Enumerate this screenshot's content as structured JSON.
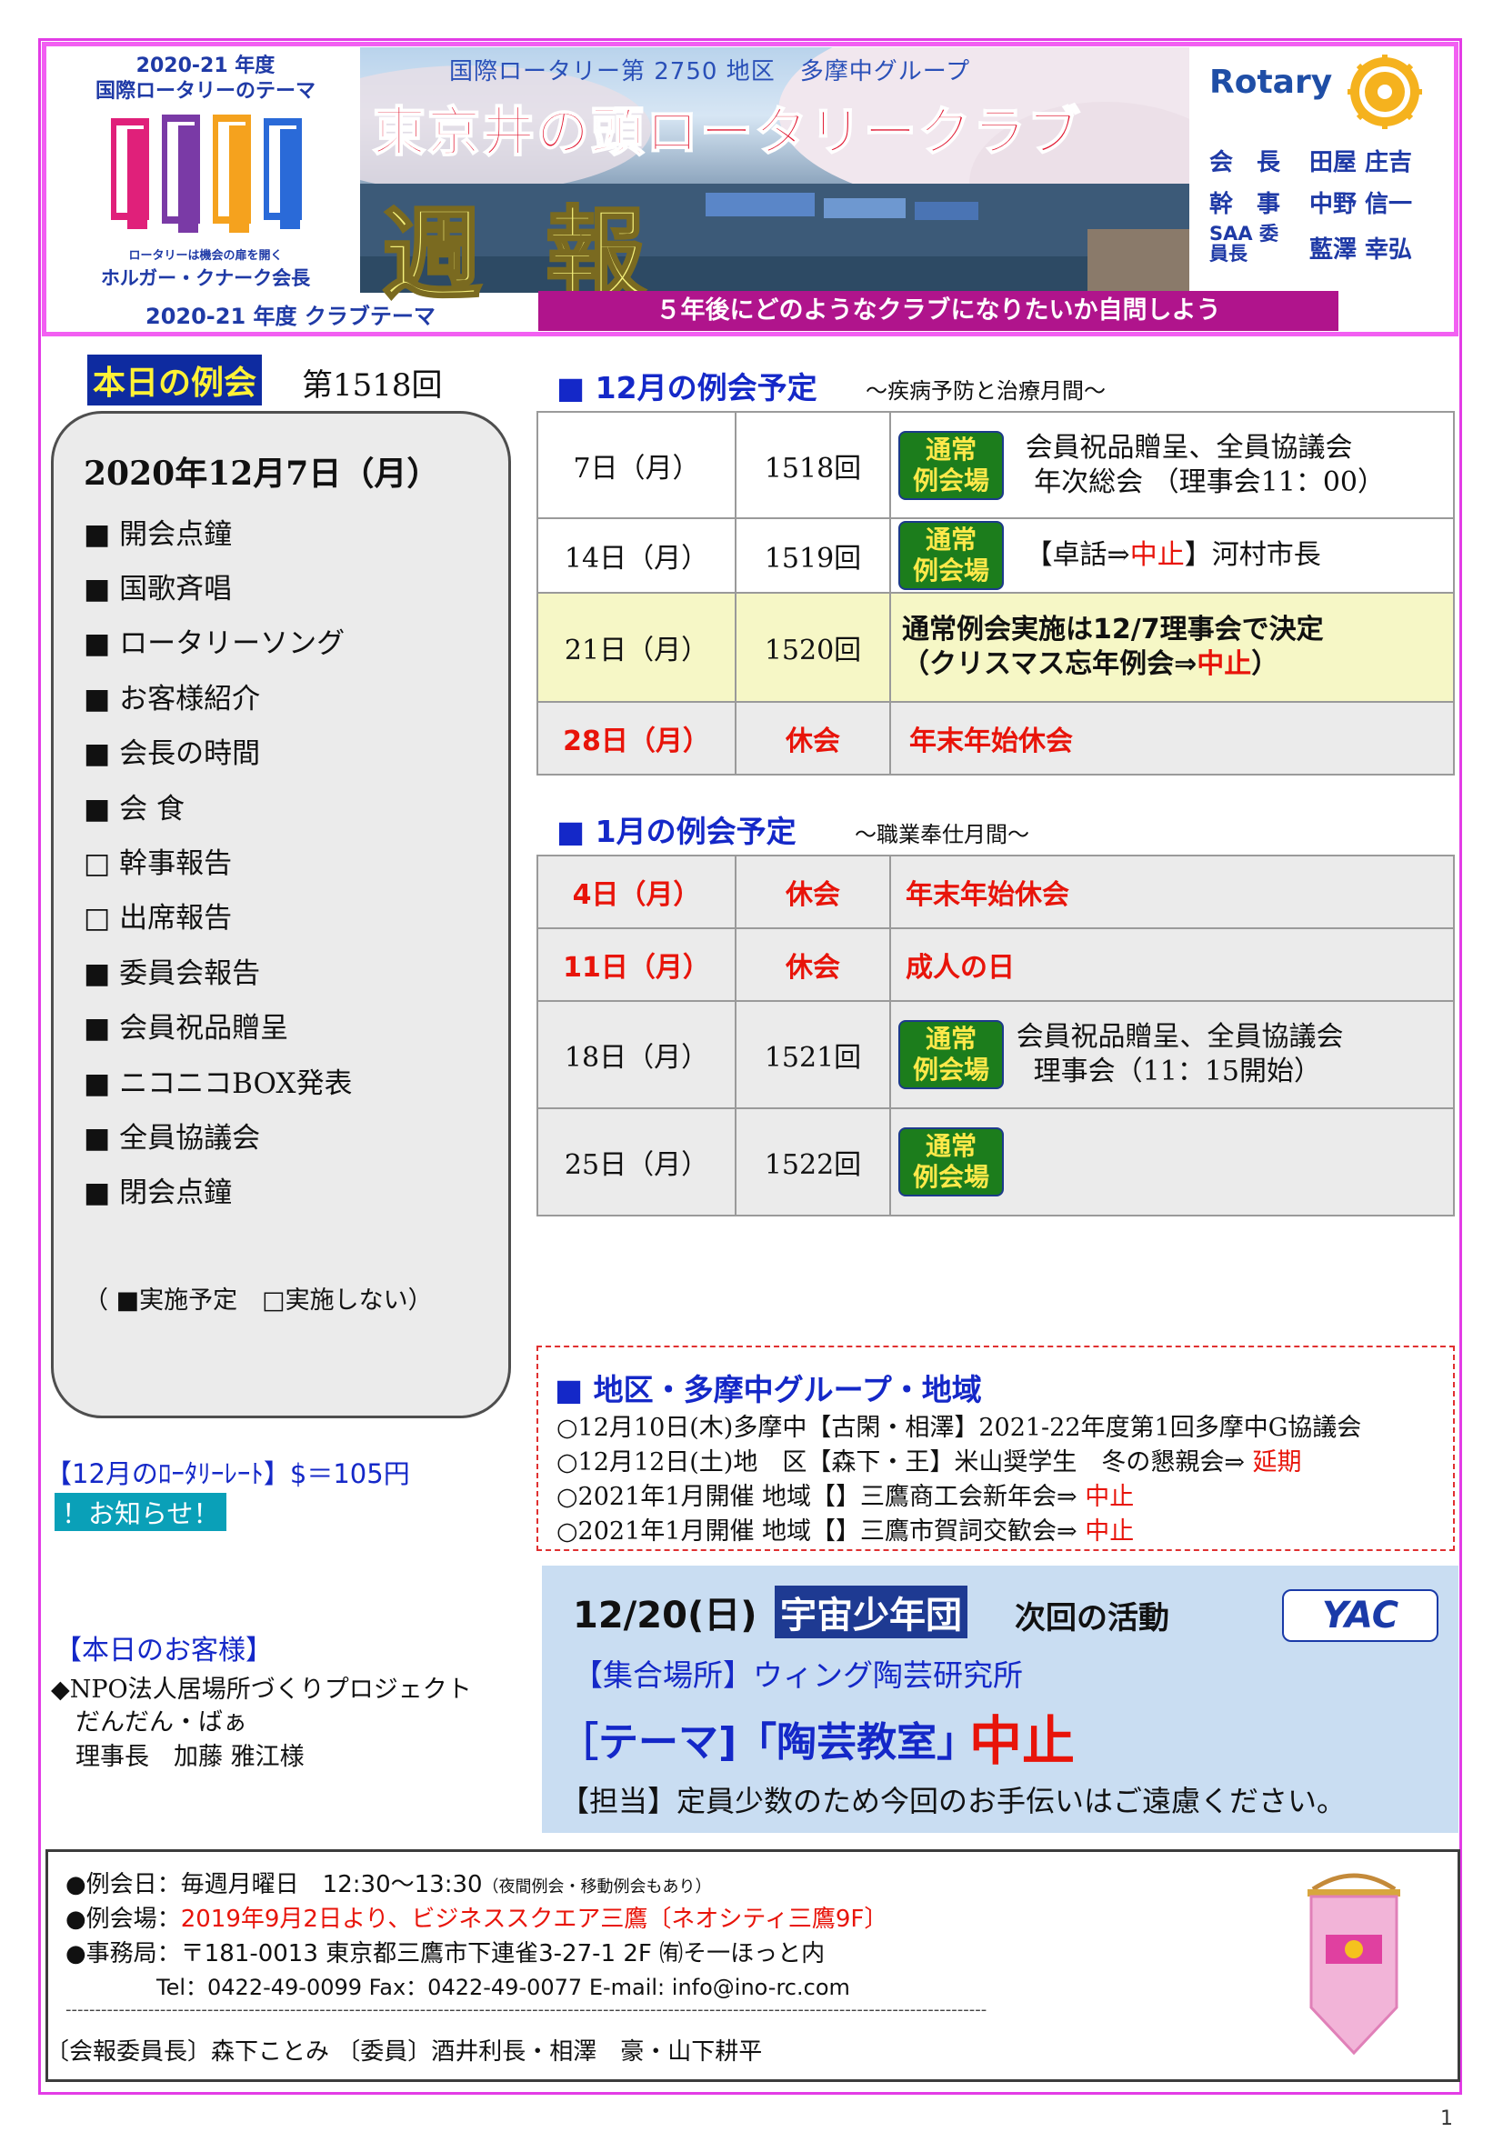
{
  "header": {
    "theme_year": "2020-21 年度",
    "theme_label": "国際ロータリーのテーマ",
    "theme_sub": "ロータリーは機会の扉を開く",
    "theme_president": "ホルガー・クナーク会長",
    "district": "国際ロータリー第 2750 地区　多摩中グループ",
    "club_name": "東京井の頭ロータリークラブ",
    "weekly_title": "週報",
    "rotary_word": "Rotary",
    "officers": [
      {
        "role": "会　長",
        "name": "田屋 庄吉"
      },
      {
        "role": "幹　事",
        "name": "中野 信一"
      },
      {
        "role": "SAA 委員長",
        "name": "藍澤 幸弘"
      }
    ],
    "club_theme_label": "2020-21 年度 クラブテーマ",
    "club_theme": "５年後にどのようなクラブになりたいか自問しよう"
  },
  "today": {
    "label": "本日の例会",
    "number": "第1518回",
    "date": "2020年12月7日（月）",
    "agenda": [
      {
        "mark": "■",
        "text": "開会点鐘"
      },
      {
        "mark": "■",
        "text": "国歌斉唱"
      },
      {
        "mark": "■",
        "text": "ロータリーソング"
      },
      {
        "mark": "■",
        "text": "お客様紹介"
      },
      {
        "mark": "■",
        "text": "会長の時間"
      },
      {
        "mark": "■",
        "text": "会 食"
      },
      {
        "mark": "□",
        "text": "幹事報告"
      },
      {
        "mark": "□",
        "text": "出席報告"
      },
      {
        "mark": "■",
        "text": "委員会報告"
      },
      {
        "mark": "■",
        "text": "会員祝品贈呈"
      },
      {
        "mark": "■",
        "text": " ニコニコBOX発表"
      },
      {
        "mark": "■",
        "text": "全員協議会"
      },
      {
        "mark": "■",
        "text": "閉会点鐘"
      }
    ],
    "legend": "（ ■実施予定　□実施しない）"
  },
  "rate": "【12月のﾛｰﾀﾘｰﾚｰﾄ】$＝105円",
  "notice": "！お知らせ！",
  "guests": {
    "heading": "【本日のお客様】",
    "lines": [
      "◆NPO法人居場所づくりプロジェクト",
      "　だんだん・ばぁ",
      "　理事長　加藤 雅江様"
    ]
  },
  "december": {
    "title": "■ 12月の例会予定",
    "subtitle": "～疾病予防と治療月間～",
    "rows": [
      {
        "date": "7日（月）",
        "num": "1518回",
        "badge": [
          "通常",
          "例会場"
        ],
        "detail1": "会員祝品贈呈、全員協議会",
        "detail2": "年次総会 （理事会11：00）"
      },
      {
        "date": "14日（月）",
        "num": "1519回",
        "badge": [
          "通常",
          "例会場"
        ],
        "detail_pre": "【卓話⇒",
        "detail_red": "中止",
        "detail_post": "】河村市長"
      },
      {
        "date": "21日（月）",
        "num": "1520回",
        "detail1": "通常例会実施は12/7理事会で決定",
        "detail2_pre": "（クリスマス忘年例会⇒",
        "detail2_red": "中止",
        "detail2_post": "）"
      },
      {
        "date": "28日（月）",
        "num": "休会",
        "detail": "年末年始休会"
      }
    ]
  },
  "january": {
    "title": "■ 1月の例会予定",
    "subtitle": "～職業奉仕月間～",
    "rows": [
      {
        "date": "4日（月）",
        "num": "休会",
        "detail": "年末年始休会"
      },
      {
        "date": "11日（月）",
        "num": "休会",
        "detail": "成人の日"
      },
      {
        "date": "18日（月）",
        "num": "1521回",
        "badge": [
          "通常",
          "例会場"
        ],
        "detail1": "会員祝品贈呈、全員協議会",
        "detail2": "理事会（11：15開始）"
      },
      {
        "date": "25日（月）",
        "num": "1522回",
        "badge": [
          "通常",
          "例会場"
        ]
      }
    ]
  },
  "region": {
    "title": "■ 地区・多摩中グループ・地域",
    "lines": [
      {
        "text": "○12月10日(木)多摩中【古閑・相澤】2021-22年度第1回多摩中G協議会",
        "status": ""
      },
      {
        "text": "○12月12日(土)地　区【森下・王】米山奨学生　冬の懇親会⇒ ",
        "status": "延期"
      },
      {
        "text": "○2021年1月開催 地域【】三鷹商工会新年会⇒ ",
        "status": "中止"
      },
      {
        "text": "○2021年1月開催 地域【】三鷹市賀詞交歓会⇒ ",
        "status": "中止"
      }
    ]
  },
  "yac": {
    "date": "12/20(日)",
    "org": "宇宙少年団",
    "next": "次回の活動",
    "logo": "YAC",
    "place": "【集合場所】ウィング陶芸研究所",
    "theme": "［テーマ]「陶芸教室」",
    "cancel": "中止",
    "charge": "【担当】定員少数のため今回のお手伝いはご遠慮ください。"
  },
  "footer": {
    "meeting_day_label": "●例会日：毎週月曜日　12:30～13:30",
    "meeting_day_note": "（夜間例会・移動例会もあり）",
    "venue_label": "●例会場：",
    "venue": "2019年9月2日より、ビジネススクエア三鷹〔ネオシティ三鷹9F〕",
    "office": "●事務局：〒181-0013 東京都三鷹市下連雀3-27-1 2F ㈲そ一ほっと内",
    "contact": "Tel：0422-49-0099 Fax：0422-49-0077 E-mail: info@ino-rc.com",
    "dashes": "------------------------------------------------------------------------------------------------------------------------------------------------------------",
    "committee": "〔会報委員長〕森下ことみ 〔委員〕酒井利長・相澤　豪・山下耕平"
  },
  "page_number": "1"
}
